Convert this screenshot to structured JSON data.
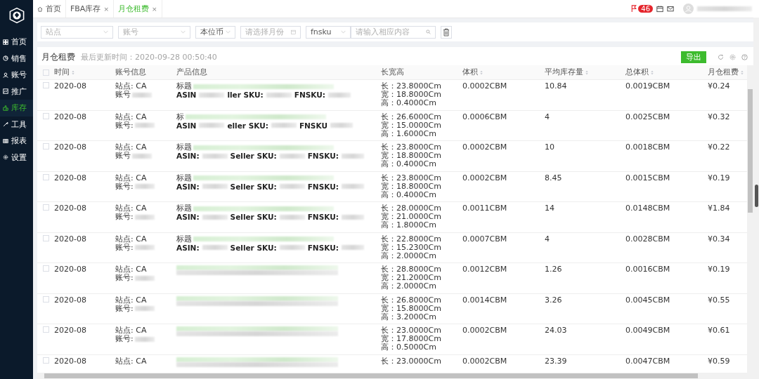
{
  "sidebar": {
    "items": [
      {
        "label": "首页",
        "selected": false
      },
      {
        "label": "销售",
        "selected": false
      },
      {
        "label": "账号",
        "selected": false
      },
      {
        "label": "推广",
        "selected": false
      },
      {
        "label": "库存",
        "selected": true
      },
      {
        "label": "工具",
        "selected": false
      },
      {
        "label": "报表",
        "selected": false
      },
      {
        "label": "设置",
        "selected": false
      }
    ]
  },
  "tabs": [
    {
      "label": "首页",
      "kind": "home",
      "selected": false
    },
    {
      "label": "FBA库存",
      "kind": "closable",
      "close": "×",
      "selected": false
    },
    {
      "label": "月仓租费",
      "kind": "closable",
      "close": "×",
      "selected": true
    }
  ],
  "header": {
    "badge": "46"
  },
  "filters": {
    "site": {
      "placeholder": "站点"
    },
    "account": {
      "placeholder": "账号"
    },
    "currency": {
      "value": "本位币"
    },
    "month": {
      "placeholder": "请选择月份"
    },
    "search_type": {
      "value": "fnsku"
    },
    "search": {
      "placeholder": "请输入相应内容"
    }
  },
  "card": {
    "title": "月仓租费",
    "updated": "最后更新时间：2020-09-28 00:50:40",
    "export": "导出"
  },
  "table": {
    "all_checked": false,
    "columns": [
      {
        "label": "时间",
        "sortable": true
      },
      {
        "label": "账号信息",
        "sortable": false
      },
      {
        "label": "产品信息",
        "sortable": false
      },
      {
        "label": "长宽高",
        "sortable": false
      },
      {
        "label": "体积",
        "sortable": true
      },
      {
        "label": "平均库存量",
        "sortable": true
      },
      {
        "label": "总体积",
        "sortable": true
      },
      {
        "label": "月仓租费",
        "sortable": true
      }
    ],
    "rows": [
      {
        "checked": false,
        "time": "2020-08",
        "site": "站点: CA",
        "account": "账号",
        "product": {
          "kind": "labeled",
          "title": "标题",
          "asin": "ASIN",
          "sku": "ller SKU:",
          "fnsku": "FNSKU:"
        },
        "dims": [
          "长：23.8000Cm",
          "宽：18.8000Cm",
          "高：0.4000Cm"
        ],
        "volume": "0.0002CBM",
        "avg": "10.84",
        "total": "0.0019CBM",
        "fee": "¥0.24"
      },
      {
        "checked": false,
        "time": "2020-08",
        "site": "站点: CA",
        "account": "账号:",
        "product": {
          "kind": "labeled",
          "title": "标",
          "asin": "ASIN",
          "sku": "eller SKU:",
          "fnsku": "FNSKU"
        },
        "dims": [
          "长：26.6000Cm",
          "宽：15.0000Cm",
          "高：1.6000Cm"
        ],
        "volume": "0.0006CBM",
        "avg": "4",
        "total": "0.0025CBM",
        "fee": "¥0.32"
      },
      {
        "checked": false,
        "time": "2020-08",
        "site": "站点: CA",
        "account": "账号",
        "product": {
          "kind": "labeled",
          "title": "标题",
          "asin": "ASIN:",
          "sku": "Seller SKU:",
          "fnsku": "FNSKU:"
        },
        "dims": [
          "长：23.8000Cm",
          "宽：18.8000Cm",
          "高：0.4000Cm"
        ],
        "volume": "0.0002CBM",
        "avg": "10",
        "total": "0.0018CBM",
        "fee": "¥0.22"
      },
      {
        "checked": false,
        "time": "2020-08",
        "site": "站点: CA",
        "account": "账号:",
        "product": {
          "kind": "labeled",
          "title": "标题",
          "asin": "ASIN:",
          "sku": "Seller SKU:",
          "fnsku": "FNSKU:"
        },
        "dims": [
          "长：23.8000Cm",
          "宽：18.8000Cm",
          "高：0.4000Cm"
        ],
        "volume": "0.0002CBM",
        "avg": "8.45",
        "total": "0.0015CBM",
        "fee": "¥0.19"
      },
      {
        "checked": false,
        "time": "2020-08",
        "site": "站点: CA",
        "account": "账号:",
        "product": {
          "kind": "labeled",
          "title": "标题",
          "asin": "ASIN:",
          "sku": "Seller SKU:",
          "fnsku": "FNSKU:"
        },
        "dims": [
          "长：28.0000Cm",
          "宽：21.0000Cm",
          "高：1.8000Cm"
        ],
        "volume": "0.0011CBM",
        "avg": "14",
        "total": "0.0148CBM",
        "fee": "¥1.84"
      },
      {
        "checked": false,
        "time": "2020-08",
        "site": "站点: CA",
        "account": "账号:",
        "product": {
          "kind": "labeled",
          "title": "标题",
          "asin": "ASIN:",
          "sku": "Seller SKU:",
          "fnsku": "FNSKU:"
        },
        "dims": [
          "长：22.8000Cm",
          "宽：15.2300Cm",
          "高：2.0000Cm"
        ],
        "volume": "0.0007CBM",
        "avg": "4",
        "total": "0.0028CBM",
        "fee": "¥0.34"
      },
      {
        "checked": false,
        "time": "2020-08",
        "site": "站点: CA",
        "account": "账号:",
        "product": {
          "kind": "blurred"
        },
        "dims": [
          "长：28.8000Cm",
          "宽：21.2000Cm",
          "高：2.0000Cm"
        ],
        "volume": "0.0012CBM",
        "avg": "1.26",
        "total": "0.0016CBM",
        "fee": "¥0.19"
      },
      {
        "checked": false,
        "time": "2020-08",
        "site": "站点: CA",
        "account": "账号:",
        "product": {
          "kind": "blurred"
        },
        "dims": [
          "长：26.8000Cm",
          "宽：15.8000Cm",
          "高：3.2000Cm"
        ],
        "volume": "0.0014CBM",
        "avg": "3.26",
        "total": "0.0045CBM",
        "fee": "¥0.55"
      },
      {
        "checked": false,
        "time": "2020-08",
        "site": "站点: CA",
        "account": "账号:",
        "product": {
          "kind": "blurred"
        },
        "dims": [
          "长：23.0000Cm",
          "宽：17.8000Cm",
          "高：0.5000Cm"
        ],
        "volume": "0.0002CBM",
        "avg": "24.03",
        "total": "0.0049CBM",
        "fee": "¥0.61"
      },
      {
        "checked": false,
        "time": "2020-08",
        "site": "站点: CA",
        "product": {
          "kind": "blurred"
        },
        "dims": [
          "长：23.0000Cm"
        ],
        "volume": "0.0002CBM",
        "avg": "23.39",
        "total": "0.0047CBM",
        "fee": "¥0.59"
      }
    ]
  }
}
